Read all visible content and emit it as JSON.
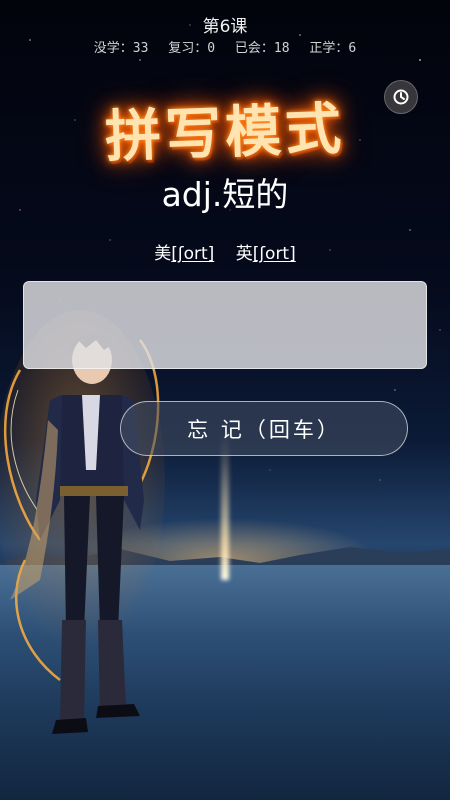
{
  "header": {
    "lesson_title": "第6课",
    "stats": {
      "unlearned": "没学：33",
      "review": "复习：0",
      "known": "已会：18",
      "learning": "正学：6"
    }
  },
  "mode_title": "拼写模式",
  "word": {
    "meaning": "adj.短的"
  },
  "phonetics": {
    "us_label": "美",
    "us_ipa": "[ʃort]",
    "uk_label": "英",
    "uk_ipa": "[ʃort]"
  },
  "spell_input": {
    "value": "",
    "placeholder": ""
  },
  "forget_button_label": "忘 记（回车）",
  "icons": {
    "history": "history-icon"
  },
  "colors": {
    "title_fire": "#ff6a00",
    "input_bg": "#e1e1e4",
    "button_border": "#dcdce6"
  }
}
